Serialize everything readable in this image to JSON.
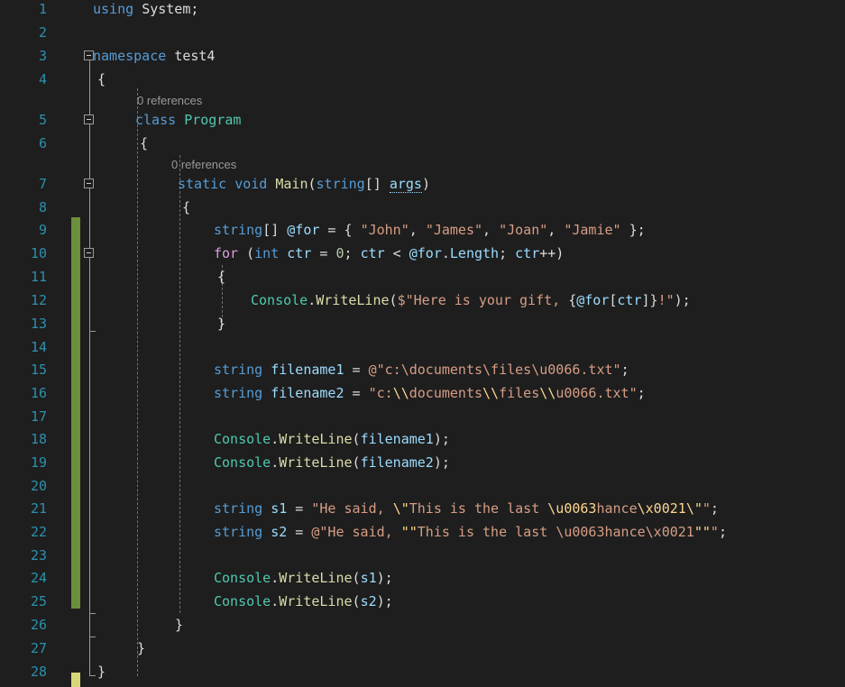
{
  "editor": {
    "theme": "visual-studio-dark",
    "background_color": "#1e1e1e",
    "line_number_color": "#2b91af",
    "change_bar_color": "#6b8f3a",
    "pending_change_bar_color": "#d7d77a",
    "font_size_px": 15,
    "line_height_px": 26,
    "total_lines": 28
  },
  "line_numbers": [
    "1",
    "2",
    "3",
    "4",
    "5",
    "6",
    "7",
    "8",
    "9",
    "10",
    "11",
    "12",
    "13",
    "14",
    "15",
    "16",
    "17",
    "18",
    "19",
    "20",
    "21",
    "22",
    "23",
    "24",
    "25",
    "26",
    "27",
    "28"
  ],
  "codelens": [
    {
      "id": "class-program",
      "text": "0 references"
    },
    {
      "id": "method-main",
      "text": "0 references"
    }
  ],
  "lines": [
    {
      "n": "1",
      "text": "using System;"
    },
    {
      "n": "2",
      "text": ""
    },
    {
      "n": "3",
      "text": "namespace test4"
    },
    {
      "n": "4",
      "text": "{"
    },
    {
      "n": "5",
      "text": "    class Program"
    },
    {
      "n": "6",
      "text": "    {"
    },
    {
      "n": "7",
      "text": "        static void Main(string[] args)"
    },
    {
      "n": "8",
      "text": "        {"
    },
    {
      "n": "9",
      "text": "            string[] @for = { \"John\", \"James\", \"Joan\", \"Jamie\" };"
    },
    {
      "n": "10",
      "text": "            for (int ctr = 0; ctr < @for.Length; ctr++)"
    },
    {
      "n": "11",
      "text": "            {"
    },
    {
      "n": "12",
      "text": "                Console.WriteLine($\"Here is your gift, {@for[ctr]}!\");"
    },
    {
      "n": "13",
      "text": "            }"
    },
    {
      "n": "14",
      "text": ""
    },
    {
      "n": "15",
      "text": "            string filename1 = @\"c:\\documents\\files\\u0066.txt\";"
    },
    {
      "n": "16",
      "text": "            string filename2 = \"c:\\\\documents\\\\files\\\\u0066.txt\";"
    },
    {
      "n": "17",
      "text": ""
    },
    {
      "n": "18",
      "text": "            Console.WriteLine(filename1);"
    },
    {
      "n": "19",
      "text": "            Console.WriteLine(filename2);"
    },
    {
      "n": "20",
      "text": ""
    },
    {
      "n": "21",
      "text": "            string s1 = \"He said, \\\"This is the last \\u0063hance\\x0021\\\"\";"
    },
    {
      "n": "22",
      "text": "            string s2 = @\"He said, \"\"This is the last \\u0063hance\\x0021\"\"\";"
    },
    {
      "n": "23",
      "text": ""
    },
    {
      "n": "24",
      "text": "            Console.WriteLine(s1);"
    },
    {
      "n": "25",
      "text": "            Console.WriteLine(s2);"
    },
    {
      "n": "26",
      "text": "        }"
    },
    {
      "n": "27",
      "text": "    }"
    },
    {
      "n": "28",
      "text": "}"
    }
  ],
  "tokens": {
    "l1": [
      [
        "using",
        "k"
      ],
      [
        " ",
        "p"
      ],
      [
        "System",
        "ns"
      ],
      [
        ";",
        "p"
      ]
    ],
    "l3": [
      [
        "namespace",
        "k"
      ],
      [
        " ",
        "p"
      ],
      [
        "test4",
        "ns"
      ]
    ],
    "l4": [
      [
        "{",
        "p"
      ]
    ],
    "l5": [
      [
        "class",
        "k"
      ],
      [
        " ",
        "p"
      ],
      [
        "Program",
        "t"
      ]
    ],
    "l6": [
      [
        "{",
        "p"
      ]
    ],
    "l7": [
      [
        "static",
        "k"
      ],
      [
        " ",
        "p"
      ],
      [
        "void",
        "k"
      ],
      [
        " ",
        "p"
      ],
      [
        "Main",
        "m"
      ],
      [
        "(",
        "p"
      ],
      [
        "string",
        "k"
      ],
      [
        "[] ",
        "p"
      ],
      [
        "args",
        "unused"
      ],
      [
        ")",
        "p"
      ]
    ],
    "l8": [
      [
        "{",
        "p"
      ]
    ],
    "l9": [
      [
        "string",
        "k"
      ],
      [
        "[] ",
        "p"
      ],
      [
        "@for",
        "v"
      ],
      [
        " = { ",
        "p"
      ],
      [
        "\"John\"",
        "s"
      ],
      [
        ", ",
        "p"
      ],
      [
        "\"James\"",
        "s"
      ],
      [
        ", ",
        "p"
      ],
      [
        "\"Joan\"",
        "s"
      ],
      [
        ", ",
        "p"
      ],
      [
        "\"Jamie\"",
        "s"
      ],
      [
        " };",
        "p"
      ]
    ],
    "l10": [
      [
        "for",
        "kc"
      ],
      [
        " (",
        "p"
      ],
      [
        "int",
        "k"
      ],
      [
        " ",
        "p"
      ],
      [
        "ctr",
        "v"
      ],
      [
        " = ",
        "p"
      ],
      [
        "0",
        "n"
      ],
      [
        "; ",
        "p"
      ],
      [
        "ctr",
        "v"
      ],
      [
        " < ",
        "p"
      ],
      [
        "@for",
        "v"
      ],
      [
        ".",
        "p"
      ],
      [
        "Length",
        "v"
      ],
      [
        "; ",
        "p"
      ],
      [
        "ctr",
        "v"
      ],
      [
        "++)",
        "p"
      ]
    ],
    "l11": [
      [
        "{",
        "p"
      ]
    ],
    "l12": [
      [
        "Console",
        "t"
      ],
      [
        ".",
        "p"
      ],
      [
        "WriteLine",
        "m"
      ],
      [
        "(",
        "p"
      ],
      [
        "$\"Here is your gift, ",
        "s"
      ],
      [
        "{",
        "p"
      ],
      [
        "@for",
        "v"
      ],
      [
        "[",
        "p"
      ],
      [
        "ctr",
        "v"
      ],
      [
        "]",
        "p"
      ],
      [
        "}",
        "p"
      ],
      [
        "!\"",
        "s"
      ],
      [
        ");",
        "p"
      ]
    ],
    "l13": [
      [
        "}",
        "p"
      ]
    ],
    "l15": [
      [
        "string",
        "k"
      ],
      [
        " ",
        "p"
      ],
      [
        "filename1",
        "v"
      ],
      [
        " = ",
        "p"
      ],
      [
        "@\"c:\\documents\\files\\u0066.txt\"",
        "s"
      ],
      [
        ";",
        "p"
      ]
    ],
    "l16": [
      [
        "string",
        "k"
      ],
      [
        " ",
        "p"
      ],
      [
        "filename2",
        "v"
      ],
      [
        " = ",
        "p"
      ],
      [
        "\"c:",
        "s"
      ],
      [
        "\\\\",
        "e"
      ],
      [
        "documents",
        "s"
      ],
      [
        "\\\\",
        "e"
      ],
      [
        "files",
        "s"
      ],
      [
        "\\\\",
        "e"
      ],
      [
        "u0066.txt\"",
        "s"
      ],
      [
        ";",
        "p"
      ]
    ],
    "l18": [
      [
        "Console",
        "t"
      ],
      [
        ".",
        "p"
      ],
      [
        "WriteLine",
        "m"
      ],
      [
        "(",
        "p"
      ],
      [
        "filename1",
        "v"
      ],
      [
        ");",
        "p"
      ]
    ],
    "l19": [
      [
        "Console",
        "t"
      ],
      [
        ".",
        "p"
      ],
      [
        "WriteLine",
        "m"
      ],
      [
        "(",
        "p"
      ],
      [
        "filename2",
        "v"
      ],
      [
        ");",
        "p"
      ]
    ],
    "l21": [
      [
        "string",
        "k"
      ],
      [
        " ",
        "p"
      ],
      [
        "s1",
        "v"
      ],
      [
        " = ",
        "p"
      ],
      [
        "\"He said, ",
        "s"
      ],
      [
        "\\\"",
        "e"
      ],
      [
        "This is the last ",
        "s"
      ],
      [
        "\\u0063",
        "e"
      ],
      [
        "hance",
        "s"
      ],
      [
        "\\x0021",
        "e"
      ],
      [
        "\\\"",
        "e"
      ],
      [
        "\"",
        "s"
      ],
      [
        ";",
        "p"
      ]
    ],
    "l22": [
      [
        "string",
        "k"
      ],
      [
        " ",
        "p"
      ],
      [
        "s2",
        "v"
      ],
      [
        " = ",
        "p"
      ],
      [
        "@\"He said, ",
        "s"
      ],
      [
        "\"\"",
        "e"
      ],
      [
        "This is the last ",
        "s"
      ],
      [
        "\\u0063hance\\x0021",
        "s"
      ],
      [
        "\"\"",
        "e"
      ],
      [
        "\"",
        "s"
      ],
      [
        ";",
        "p"
      ]
    ],
    "l24": [
      [
        "Console",
        "t"
      ],
      [
        ".",
        "p"
      ],
      [
        "WriteLine",
        "m"
      ],
      [
        "(",
        "p"
      ],
      [
        "s1",
        "v"
      ],
      [
        ");",
        "p"
      ]
    ],
    "l25": [
      [
        "Console",
        "t"
      ],
      [
        ".",
        "p"
      ],
      [
        "WriteLine",
        "m"
      ],
      [
        "(",
        "p"
      ],
      [
        "s2",
        "v"
      ],
      [
        ");",
        "p"
      ]
    ],
    "l26": [
      [
        "}",
        "p"
      ]
    ],
    "l27": [
      [
        "}",
        "p"
      ]
    ],
    "l28": [
      [
        "}",
        "p"
      ]
    ]
  }
}
